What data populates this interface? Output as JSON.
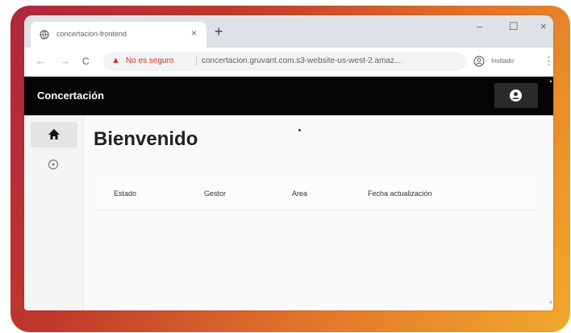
{
  "browser": {
    "tab_title": "concertacion-frontend",
    "tab_close": "×",
    "new_tab": "+",
    "minimize": "–",
    "maximize": "☐",
    "close": "×",
    "back": "←",
    "forward": "→",
    "reload": "C",
    "warning_icon": "▲",
    "security_text": "No es seguro",
    "separator": "|",
    "url": "concertacion.gruvant.com.s3-website-us-west-2.amaz...",
    "profile_label": "Invitado",
    "menu": "⋮"
  },
  "app": {
    "title": "Concertación",
    "account_icon": "account-circle-icon"
  },
  "sidebar": {
    "items": [
      {
        "icon": "home-icon"
      },
      {
        "icon": "circle-outline-icon"
      }
    ]
  },
  "main": {
    "title": "Bienvenido",
    "table": {
      "columns": [
        "Estado",
        "Gestor",
        "Area",
        "Fecha actualización"
      ],
      "rows": []
    }
  },
  "colors": {
    "frame_gradient": [
      "#b0263e",
      "#e2712a",
      "#f1a92b"
    ],
    "appbar": "#050505",
    "insecure": "#d93025"
  }
}
